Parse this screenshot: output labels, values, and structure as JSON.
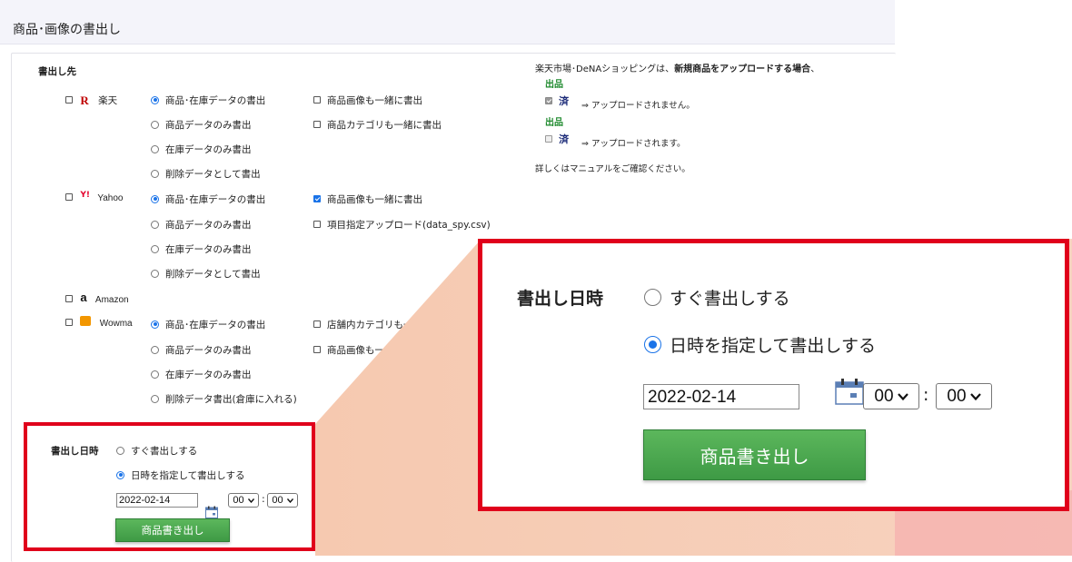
{
  "page": {
    "title": "商品･画像の書出し"
  },
  "export": {
    "section_label": "書出し先",
    "rakuten": {
      "name": "楽天",
      "options": [
        "商品･在庫データの書出",
        "商品データのみ書出",
        "在庫データのみ書出",
        "削除データとして書出"
      ],
      "extras": [
        "商品画像も一緒に書出",
        "商品カテゴリも一緒に書出"
      ]
    },
    "yahoo": {
      "name": "Yahoo",
      "options": [
        "商品･在庫データの書出",
        "商品データのみ書出",
        "在庫データのみ書出",
        "削除データとして書出"
      ],
      "extras": [
        "商品画像も一緒に書出",
        "項目指定アップロード(data_spy.csv)"
      ]
    },
    "amazon": {
      "name": "Amazon"
    },
    "wowma": {
      "name": "Wowma",
      "options": [
        "商品･在庫データの書出",
        "商品データのみ書出",
        "在庫データのみ書出",
        "削除データ書出(倉庫に入れる)"
      ],
      "extras": [
        "店舗内カテゴリも一緒に書出",
        "商品画像も一緒に書出"
      ]
    }
  },
  "note": {
    "line1_a": "楽天市場･DeNAショッピングは、",
    "line1_b": "新規商品をアップロードする場合",
    "line1_c": "、",
    "badge_top": "出品",
    "badge_bottom": "済",
    "checked_text": "⇒ アップロードされません。",
    "unchecked_text": "⇒ アップロードされます。",
    "footer": "詳しくはマニュアルをご確認ください。"
  },
  "schedule": {
    "label": "書出し日時",
    "option_now": "すぐ書出しする",
    "option_specify": "日時を指定して書出しする",
    "date": "2022-02-14",
    "hour": "00",
    "minute": "00",
    "colon": ":",
    "button": "商品書き出し"
  },
  "icons": {
    "rakuten": "rakuten-logo-icon",
    "yahoo": "yahoo-logo-icon",
    "amazon": "amazon-logo-icon",
    "wowma": "wowma-logo-icon",
    "calendar": "calendar-icon",
    "dropdown": "chevron-down-icon"
  },
  "colors": {
    "highlight_border": "#e0001b",
    "button_green": "#3e9a45",
    "badge_green": "#1f8a2e",
    "badge_navy": "#1b2a78",
    "radio_blue": "#1a73e8",
    "zoom_wedge": "#f6c9b0"
  }
}
